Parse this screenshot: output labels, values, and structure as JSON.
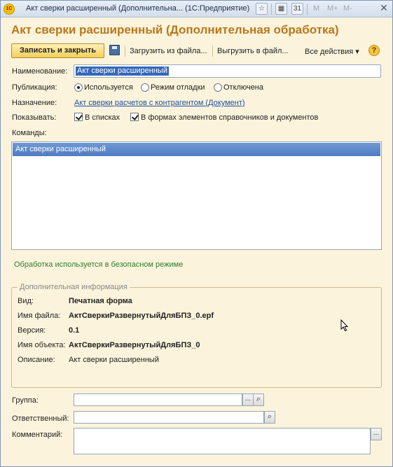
{
  "window": {
    "title": "Акт сверки расширенный (Дополнительна...  (1С:Предприятие)",
    "toolbar_m_buttons": [
      "M",
      "M+",
      "M-"
    ]
  },
  "form": {
    "title": "Акт сверки расширенный (Дополнительная обработка)"
  },
  "toolbar": {
    "save_close_label": "Записать и закрыть",
    "load_label": "Загрузить из файла...",
    "unload_label": "Выгрузить в файл...",
    "all_actions_label": "Все действия ▾",
    "help_label": "?"
  },
  "fields": {
    "name_label": "Наименование:",
    "name_value": "Акт сверки расширенный",
    "publication_label": "Публикация:",
    "publication_options": [
      "Используется",
      "Режим отладки",
      "Отключена"
    ],
    "publication_selected": "Используется",
    "purpose_label": "Назначение:",
    "purpose_value": "Акт сверки расчетов с контрагентом (Документ)",
    "show_label": "Показывать:",
    "show_in_lists": "В списках",
    "show_in_forms": "В формах элементов справочников и документов",
    "commands_label": "Команды:",
    "commands": [
      "Акт сверки расширенный"
    ]
  },
  "safe_mode_note": "Обработка используется в безопасном режиме",
  "additional_info": {
    "title": "Дополнительная информация",
    "kind_label": "Вид:",
    "kind_value": "Печатная форма",
    "file_label": "Имя файла:",
    "file_value": "АктСверкиРазвернутыйДляБПЗ_0.epf",
    "version_label": "Версия:",
    "version_value": "0.1",
    "object_label": "Имя объекта:",
    "object_value": "АктСверкиРазвернутыйДляБПЗ_0",
    "description_label": "Описание:",
    "description_value": "Акт сверки расширенный"
  },
  "footer_fields": {
    "group_label": "Группа:",
    "responsible_label": "Ответственный:",
    "comment_label": "Комментарий:",
    "ellipsis": "...",
    "search_glyph": "🔍"
  },
  "colors": {
    "title_orange": "#b9781a",
    "background": "#fbf3dc",
    "link_blue": "#1f4fa0",
    "selection_blue": "#3567b8",
    "safe_green": "#2f7d2c"
  }
}
